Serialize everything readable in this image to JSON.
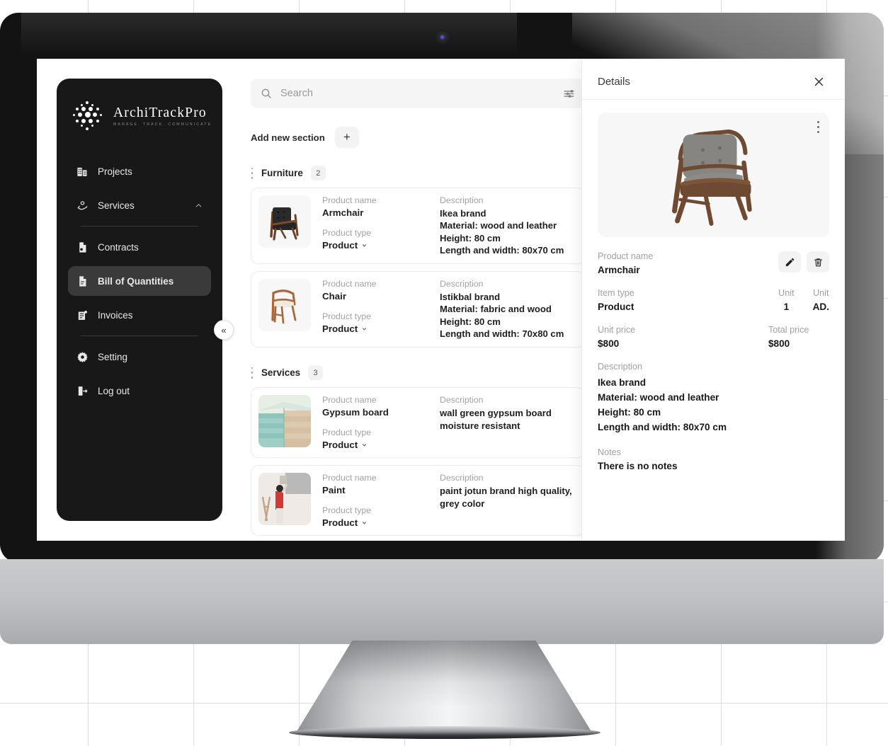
{
  "brand": {
    "name": "ArchiTrackPro",
    "tagline": "MANAGE. TRACK. COMMUNICATE"
  },
  "sidebar": {
    "items": [
      {
        "label": "Projects",
        "icon": "buildings-icon",
        "active": false
      },
      {
        "label": "Services",
        "icon": "services-icon",
        "active": false,
        "expandable": true
      },
      {
        "label": "Contracts",
        "icon": "contract-document-icon",
        "active": false
      },
      {
        "label": "Bill of Quantities",
        "icon": "bill-document-icon",
        "active": true
      },
      {
        "label": "Invoices",
        "icon": "invoice-icon",
        "active": false
      },
      {
        "label": "Setting",
        "icon": "gear-icon",
        "active": false
      },
      {
        "label": "Log out",
        "icon": "logout-icon",
        "active": false
      }
    ],
    "collapse_label": "«"
  },
  "search": {
    "placeholder": "Search",
    "value": "",
    "search_icon": "search-icon",
    "filter_icon": "filter-sliders-icon"
  },
  "toolbar": {
    "add_section_label": "Add new section",
    "add_section_button": "+"
  },
  "labels": {
    "product_name": "Product name",
    "product_type": "Product type",
    "description": "Description"
  },
  "sections": [
    {
      "title": "Furniture",
      "count": "2",
      "items": [
        {
          "name": "Armchair",
          "type": "Product",
          "thumb": "armchair-black-leather-thumb",
          "description": [
            "Ikea brand",
            "Material: wood and leather",
            "Height: 80 cm",
            "Length and width: 80x70 cm"
          ]
        },
        {
          "name": "Chair",
          "type": "Product",
          "thumb": "wooden-chair-thumb",
          "description": [
            "Istikbal brand",
            "Material: fabric and wood",
            "Height: 80 cm",
            "Length and width: 70x80 cm"
          ]
        }
      ]
    },
    {
      "title": "Services",
      "count": "3",
      "items": [
        {
          "name": "Gypsum board",
          "type": "Product",
          "thumb": "gypsum-board-stack-thumb",
          "description": [
            "wall green gypsum board moisture resistant"
          ]
        },
        {
          "name": "Paint",
          "type": "Product",
          "thumb": "painter-wall-thumb",
          "description": [
            "paint jotun brand high quality, grey color"
          ]
        }
      ]
    }
  ],
  "details": {
    "title": "Details",
    "close_icon": "close-icon",
    "hero_image": "grey-armchair-wooden-frame",
    "hero_menu_icon": "more-vertical-icon",
    "edit_icon": "pencil-icon",
    "delete_icon": "trash-icon",
    "product_name_label": "Product name",
    "product_name_value": "Armchair",
    "item_type_label": "Item type",
    "item_type_value": "Product",
    "unit_qty_label": "Unit",
    "unit_qty_value": "1",
    "unit_measure_label": "Unit",
    "unit_measure_value": "AD.",
    "unit_price_label": "Unit price",
    "unit_price_value": "$800",
    "total_price_label": "Total price",
    "total_price_value": "$800",
    "description_label": "Description",
    "description_value": "Ikea brand\nMaterial: wood and leather\nHeight: 80 cm\nLength and width: 80x70 cm",
    "notes_label": "Notes",
    "notes_value": "There is no notes"
  },
  "colors": {
    "sidebar_bg": "#181818",
    "sidebar_active": "#3a3a3a",
    "screen_bg": "#ffffff",
    "muted_text": "#a0a0a0",
    "body_text": "#181818",
    "monitor_frame": "#131313"
  }
}
